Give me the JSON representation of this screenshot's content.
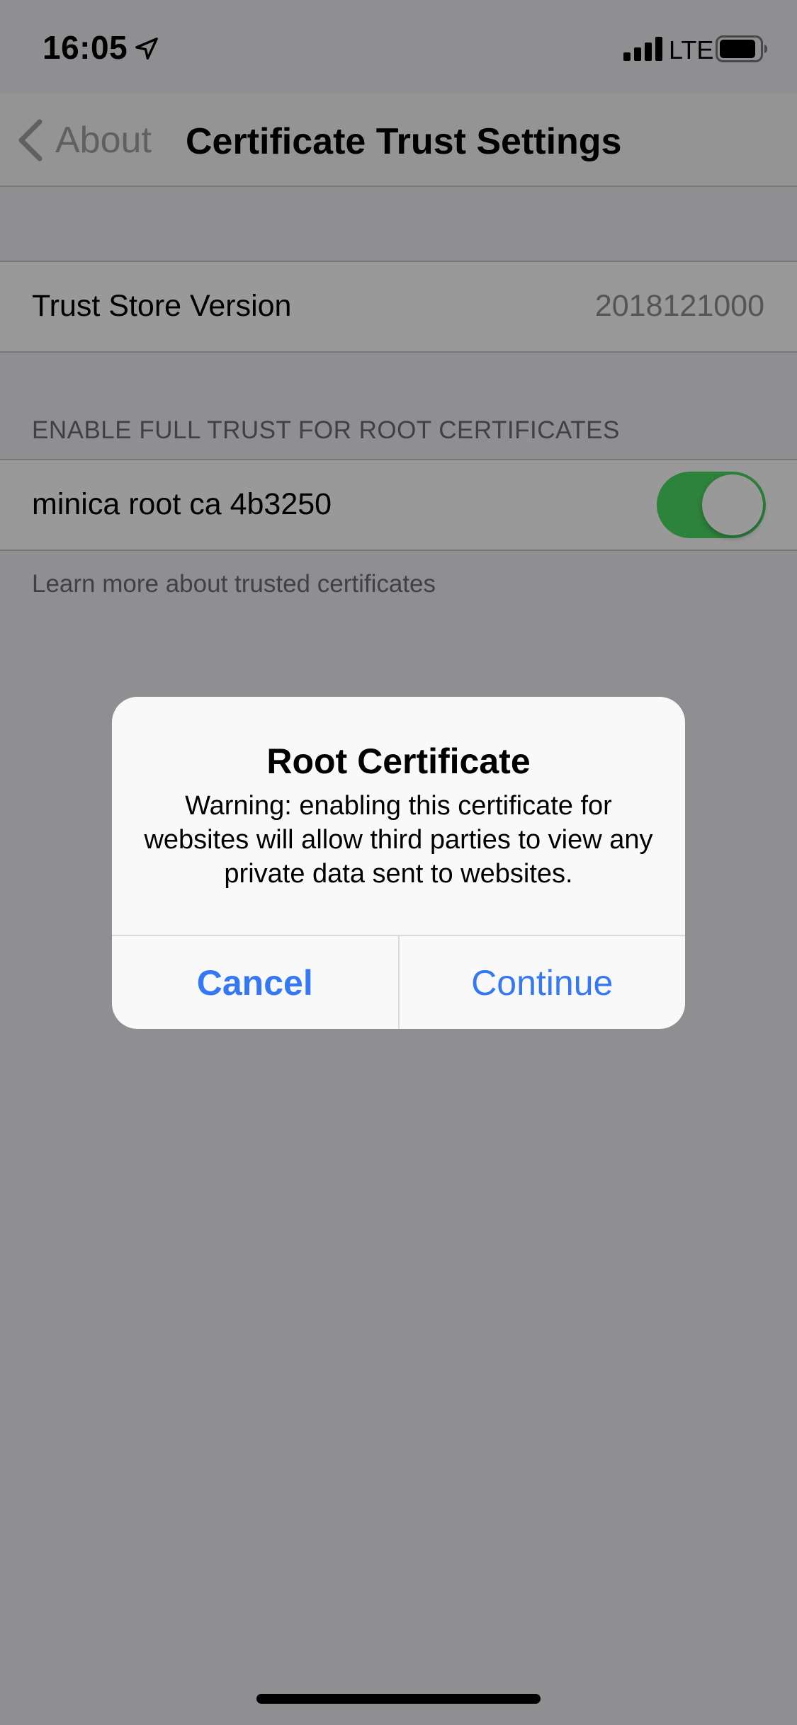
{
  "status_bar": {
    "time": "16:05",
    "network": "LTE",
    "icons": [
      "location-arrow-icon",
      "cellular-signal-icon",
      "battery-icon"
    ]
  },
  "nav_bar": {
    "back_label": "About",
    "title": "Certificate Trust Settings",
    "back_icon": "chevron-left-icon"
  },
  "trust_store": {
    "label": "Trust Store Version",
    "value": "2018121000"
  },
  "root_certs_section": {
    "header": "ENABLE FULL TRUST FOR ROOT CERTIFICATES",
    "items": [
      {
        "label": "minica root ca 4b3250",
        "enabled": true
      }
    ],
    "footer": "Learn more about trusted certificates"
  },
  "alert": {
    "title": "Root Certificate",
    "message": "Warning: enabling this certificate for websites will allow third parties to view any private data sent to websites.",
    "cancel_label": "Cancel",
    "continue_label": "Continue"
  },
  "colors": {
    "accent": "#3478f6",
    "toggle_on": "#4cd964",
    "background": "#efeff4"
  }
}
